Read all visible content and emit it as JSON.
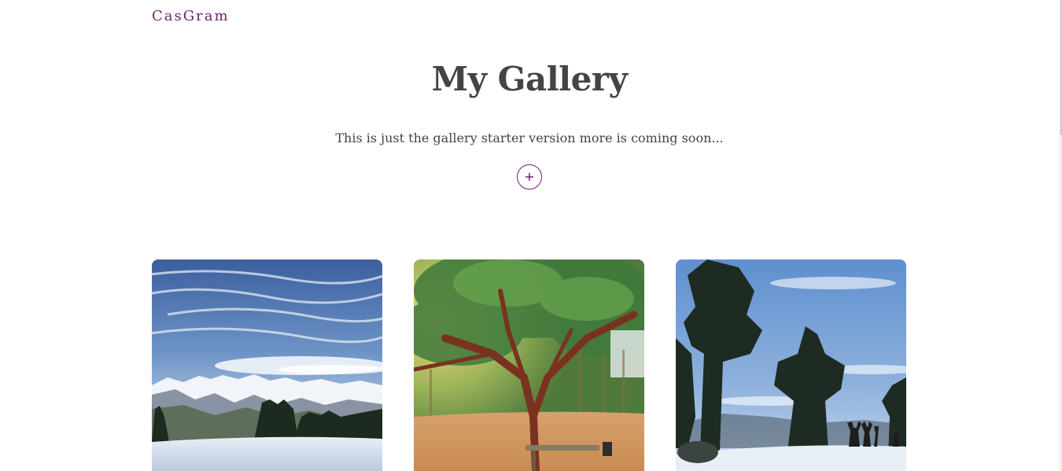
{
  "header": {
    "brand": "CasGram"
  },
  "hero": {
    "title": "My Gallery",
    "subtitle": "This is just the gallery starter version more is coming soon...",
    "add_button_icon": "plus-icon"
  },
  "gallery": {
    "photos": [
      {
        "subject": "snowy mountain range under blue sky"
      },
      {
        "subject": "tree with bench in sunlit forest"
      },
      {
        "subject": "tall trees on snowy hill with people"
      }
    ]
  },
  "colors": {
    "accent": "#6e1f73",
    "heading": "#444444",
    "background": "#ffffff"
  }
}
